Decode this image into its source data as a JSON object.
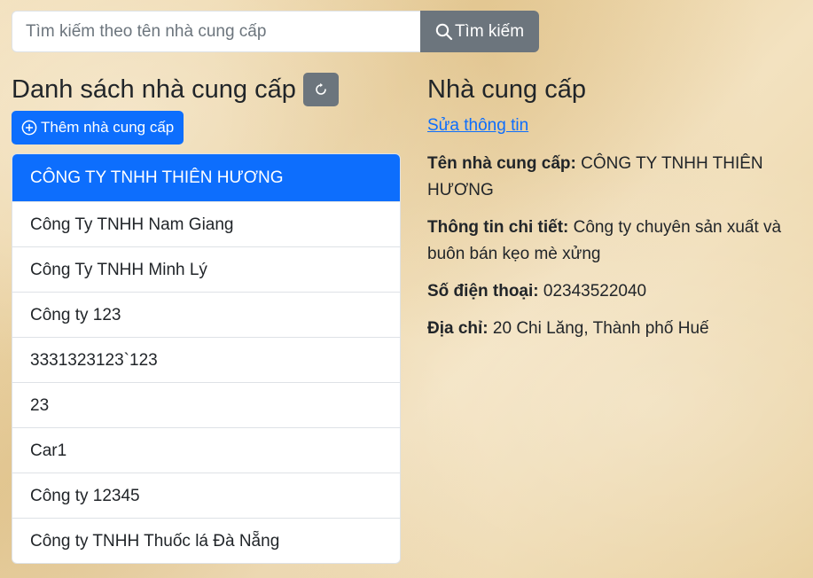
{
  "search": {
    "placeholder": "Tìm kiếm theo tên nhà cung cấp",
    "button_label": "Tìm kiếm"
  },
  "list": {
    "title": "Danh sách nhà cung cấp",
    "add_button_label": "Thêm nhà cung cấp",
    "items": [
      "CÔNG TY TNHH THIÊN HƯƠNG",
      "Công Ty TNHH Nam Giang",
      "Công Ty TNHH Minh Lý",
      "Công ty 123",
      "3331323123`123",
      "23",
      "Car1",
      "Công ty 12345",
      "Công ty TNHH Thuốc lá Đà Nẵng"
    ],
    "active_index": 0
  },
  "detail": {
    "title": "Nhà cung cấp",
    "edit_link": "Sửa thông tin",
    "name_label": "Tên nhà cung cấp:",
    "name_value": "CÔNG TY TNHH THIÊN HƯƠNG",
    "info_label": "Thông tin chi tiết:",
    "info_value": "Công ty chuyên sản xuất và buôn bán kẹo mè xửng",
    "phone_label": "Số điện thoại:",
    "phone_value": "02343522040",
    "address_label": "Địa chỉ:",
    "address_value": "20 Chi Lăng, Thành phố Huế"
  },
  "colors": {
    "primary": "#0d6efd",
    "secondary": "#6c757d"
  },
  "icons": {
    "search": "search-icon",
    "refresh": "refresh-icon",
    "add": "plus-circle-icon"
  }
}
